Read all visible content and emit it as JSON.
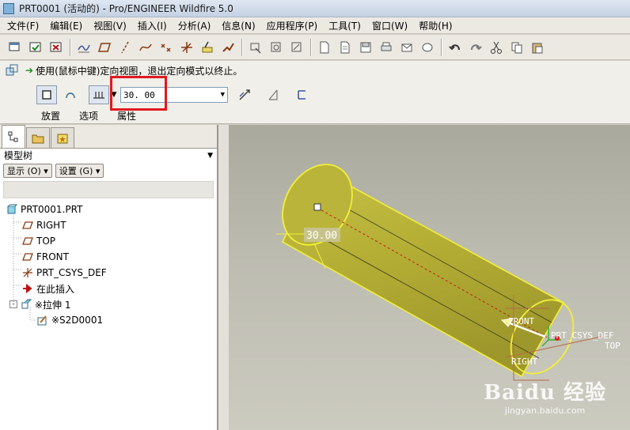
{
  "window": {
    "title": "PRT0001 (活动的) - Pro/ENGINEER Wildfire 5.0"
  },
  "menu": [
    "文件(F)",
    "编辑(E)",
    "视图(V)",
    "插入(I)",
    "分析(A)",
    "信息(N)",
    "应用程序(P)",
    "工具(T)",
    "窗口(W)",
    "帮助(H)"
  ],
  "toolbar_icons": [
    "layer-icon",
    "regen-icon",
    "close-window-icon",
    "datum-axis-icon",
    "datum-plane-icon",
    "axis-icon",
    "curve-icon",
    "point-icon",
    "csys-icon",
    "sketch-icon",
    "analysis-icon",
    "view-icon",
    "orient-icon",
    "spin-icon",
    "new-icon",
    "open-icon",
    "save-icon",
    "print-icon",
    "mail-icon",
    "undo-icon",
    "redo-icon",
    "cut-icon",
    "copy-icon",
    "paste-icon"
  ],
  "message": "使用(鼠标中键)定向视图，退出定向模式以终止。",
  "dashboard": {
    "depth_value": "30. 00",
    "tabs": [
      "放置",
      "选项",
      "属性"
    ]
  },
  "model_tree": {
    "title": "模型树",
    "show_button": "显示 (O) ▾",
    "settings_button": "设置 (G) ▾",
    "items": [
      {
        "label": "PRT0001.PRT",
        "icon": "part-icon"
      },
      {
        "label": "RIGHT",
        "icon": "datum-plane-icon"
      },
      {
        "label": "TOP",
        "icon": "datum-plane-icon"
      },
      {
        "label": "FRONT",
        "icon": "datum-plane-icon"
      },
      {
        "label": "PRT_CSYS_DEF",
        "icon": "csys-icon"
      },
      {
        "label": "在此插入",
        "icon": "insert-here-arrow-icon"
      },
      {
        "label": "※拉伸 1",
        "icon": "extrude-icon"
      },
      {
        "label": "※S2D0001",
        "icon": "sketch-icon"
      }
    ]
  },
  "viewport": {
    "dimension_label": "30.00",
    "datum_labels": [
      "FRONT",
      "PRT_CSYS_DEF",
      "TOP",
      "RIGHT"
    ]
  },
  "watermark": {
    "logo": "Baidu 经验",
    "url": "jingyan.baidu.com"
  },
  "colors": {
    "cylinder": "#b8b23c",
    "edge": "#f2ef3a",
    "highlight_box": "#e0191f"
  }
}
